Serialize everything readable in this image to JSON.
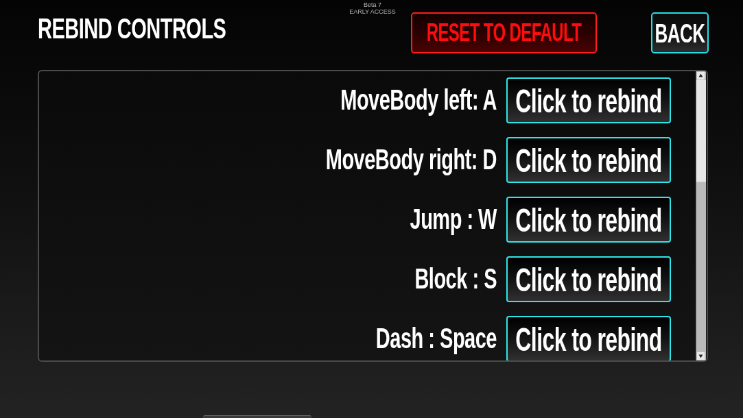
{
  "header": {
    "title": "REBIND CONTROLS",
    "build_info": {
      "version": "Beta 7",
      "stage": "EARLY ACCESS"
    },
    "buttons": [
      {
        "label": "RESET TO DEFAULT",
        "kind": "reset"
      },
      {
        "label": "BACK",
        "kind": "back"
      }
    ]
  },
  "bindings": [
    {
      "action": "MoveBody left: A",
      "button": "Click to rebind"
    },
    {
      "action": "MoveBody right: D",
      "button": "Click to rebind"
    },
    {
      "action": "Jump : W",
      "button": "Click to rebind"
    },
    {
      "action": "Block : S",
      "button": "Click to rebind"
    },
    {
      "action": "Dash : Space",
      "button": "Click to rebind"
    }
  ]
}
